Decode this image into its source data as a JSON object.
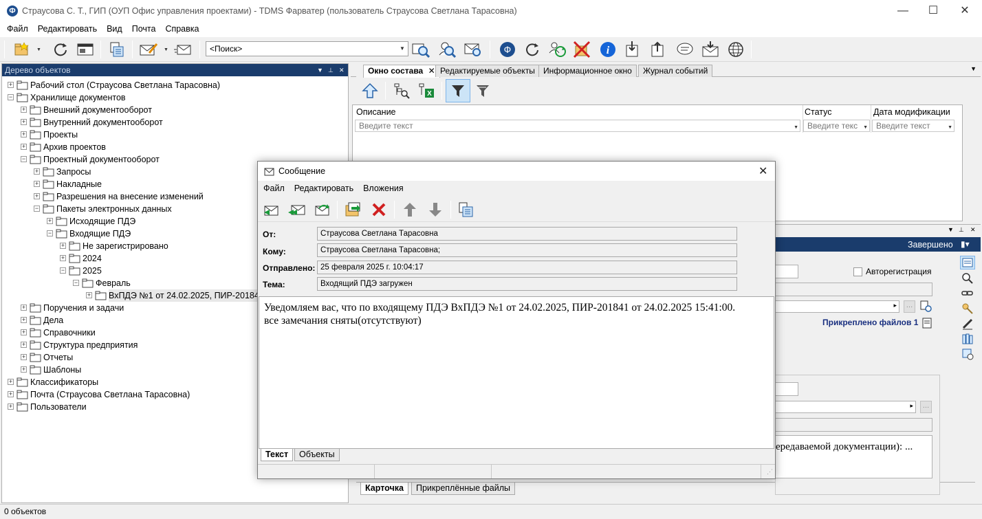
{
  "window": {
    "title": "Страусова С. Т., ГИП (ОУП Офис управления проектами) - TDMS Фарватер (пользователь Страусова Светлана Тарасовна)",
    "app_icon": "Ф"
  },
  "menu": [
    "Файл",
    "Редактировать",
    "Вид",
    "Почта",
    "Справка"
  ],
  "toolbar": {
    "search_value": "<Поиск>"
  },
  "tree": {
    "header": "Дерево объектов",
    "items": [
      {
        "label": "Рабочий стол (Страусова Светлана Тарасовна)",
        "depth": 0,
        "exp": "+"
      },
      {
        "label": "Хранилище документов",
        "depth": 0,
        "exp": "−"
      },
      {
        "label": "Внешний документооборот",
        "depth": 1,
        "exp": "+"
      },
      {
        "label": "Внутренний документооборот",
        "depth": 1,
        "exp": "+"
      },
      {
        "label": "Проекты",
        "depth": 1,
        "exp": "+"
      },
      {
        "label": "Архив проектов",
        "depth": 1,
        "exp": "+"
      },
      {
        "label": "Проектный документооборот",
        "depth": 1,
        "exp": "−"
      },
      {
        "label": "Запросы",
        "depth": 2,
        "exp": "+"
      },
      {
        "label": "Накладные",
        "depth": 2,
        "exp": "+"
      },
      {
        "label": "Разрешения на внесение изменений",
        "depth": 2,
        "exp": "+"
      },
      {
        "label": "Пакеты электронных данных",
        "depth": 2,
        "exp": "−"
      },
      {
        "label": "Исходящие ПДЭ",
        "depth": 3,
        "exp": "+"
      },
      {
        "label": "Входящие ПДЭ",
        "depth": 3,
        "exp": "−"
      },
      {
        "label": "Не зарегистрировано",
        "depth": 4,
        "exp": "+"
      },
      {
        "label": "2024",
        "depth": 4,
        "exp": "+"
      },
      {
        "label": "2025",
        "depth": 4,
        "exp": "−"
      },
      {
        "label": "Февраль",
        "depth": 5,
        "exp": "−"
      },
      {
        "label": "ВхПДЭ №1 от 24.02.2025, ПИР-20184",
        "depth": 6,
        "exp": "+",
        "selected": true
      },
      {
        "label": "Поручения и задачи",
        "depth": 1,
        "exp": "+"
      },
      {
        "label": "Дела",
        "depth": 1,
        "exp": "+"
      },
      {
        "label": "Справочники",
        "depth": 1,
        "exp": "+"
      },
      {
        "label": "Структура предприятия",
        "depth": 1,
        "exp": "+"
      },
      {
        "label": "Отчеты",
        "depth": 1,
        "exp": "+"
      },
      {
        "label": "Шаблоны",
        "depth": 1,
        "exp": "+"
      },
      {
        "label": "Классификаторы",
        "depth": 0,
        "exp": "+"
      },
      {
        "label": "Почта (Страусова Светлана Тарасовна)",
        "depth": 0,
        "exp": "+"
      },
      {
        "label": "Пользователи",
        "depth": 0,
        "exp": "+"
      }
    ]
  },
  "tabs": [
    "Окно состава",
    "Редактируемые объекты",
    "Информационное окно",
    "Журнал событий"
  ],
  "grid": {
    "columns": [
      {
        "label": "Описание",
        "placeholder": "Введите текст"
      },
      {
        "label": "Статус",
        "placeholder": "Введите текс"
      },
      {
        "label": "Дата модификации",
        "placeholder": "Введите текст"
      }
    ]
  },
  "card": {
    "status": "Завершено",
    "autoreg": "Авторегистрация",
    "attached": "Прикреплено файлов 1",
    "text_tail": "ередаваемой документации): ...",
    "tabs": [
      "Карточка",
      "Прикреплённые файлы"
    ]
  },
  "status_bar": "0 объектов",
  "dialog": {
    "title": "Сообщение",
    "menu": [
      "Файл",
      "Редактировать",
      "Вложения"
    ],
    "fields": [
      {
        "label": "От:",
        "value": "Страусова Светлана Тарасовна"
      },
      {
        "label": "Кому:",
        "value": "Страусова Светлана Тарасовна;"
      },
      {
        "label": "Отправлено:",
        "value": "25 февраля 2025 г. 10:04:17"
      },
      {
        "label": "Тема:",
        "value": "Входящий ПДЭ загружен"
      }
    ],
    "body_line1": "Уведомляем вас, что по входящему ПДЭ ВхПДЭ №1 от 24.02.2025, ПИР-201841 от 24.02.2025 15:41:00.",
    "body_line2": "все замечания сняты(отсутствуют)",
    "tabs": [
      "Текст",
      "Объекты"
    ]
  }
}
